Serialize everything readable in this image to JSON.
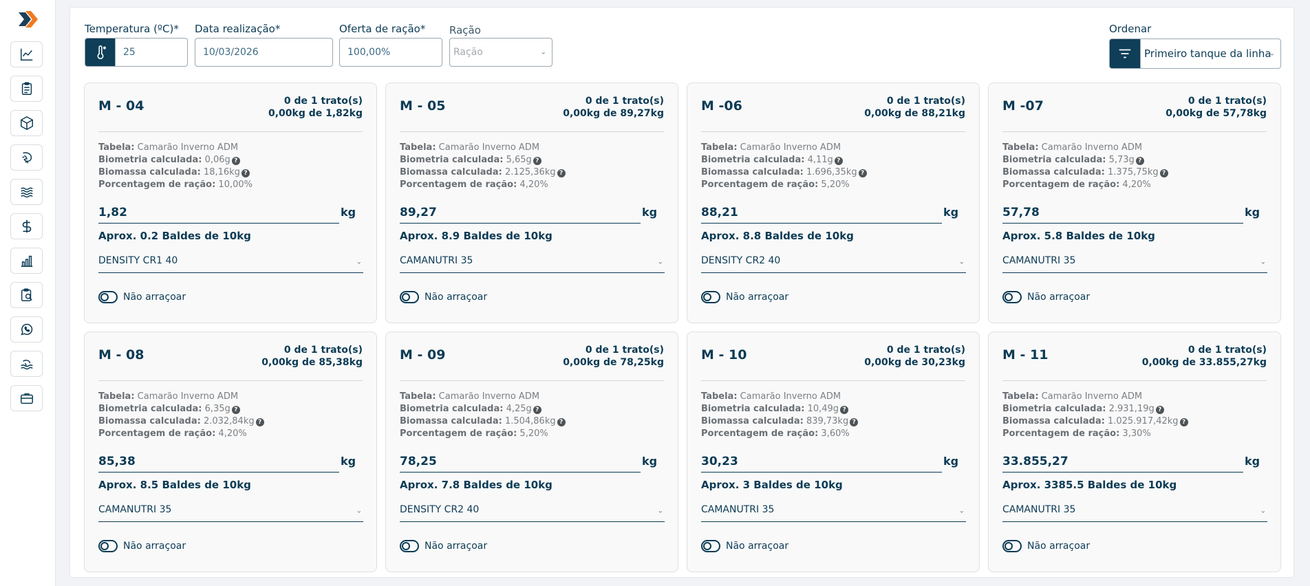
{
  "sidebar": {
    "icons": [
      "trend-chart-icon",
      "clipboard-icon",
      "box-icon",
      "shrimp-icon",
      "water-waves-icon",
      "dollar-icon",
      "bar-chart-icon",
      "inspection-icon",
      "whatsapp-icon",
      "shrimp-farm-icon",
      "briefcase-icon"
    ]
  },
  "filters": {
    "temperatura_label": "Temperatura (ºC)*",
    "temperatura_value": "25",
    "data_label": "Data realização*",
    "data_value": "10/03/2026",
    "oferta_label": "Oferta de ração*",
    "oferta_value": "100,00%",
    "racao_label": "Ração",
    "racao_placeholder": "Ração",
    "ordenar_label": "Ordenar",
    "ordenar_value": "Primeiro tanque da linha"
  },
  "labels": {
    "tabela": "Tabela:",
    "biometria": "Biometria calculada:",
    "biomassa": "Biomassa calculada:",
    "porcentagem": "Porcentagem de ração:",
    "kg": "kg",
    "nao_arracoar": "Não arraçoar"
  },
  "cards": [
    {
      "name": "M - 04",
      "trato": "0 de 1 trato(s)",
      "kg_summary": "0,00kg de 1,82kg",
      "tabela": "Camarão Inverno ADM",
      "biometria": "0,06g",
      "biomassa": "18,16kg",
      "porcentagem": "10,00%",
      "qty": "1,82",
      "aprox": "Aprox. 0.2 Baldes de 10kg",
      "racao": "DENSITY CR1 40"
    },
    {
      "name": "M - 05",
      "trato": "0 de 1 trato(s)",
      "kg_summary": "0,00kg de 89,27kg",
      "tabela": "Camarão Inverno ADM",
      "biometria": "5,65g",
      "biomassa": "2.125,36kg",
      "porcentagem": "4,20%",
      "qty": "89,27",
      "aprox": "Aprox. 8.9 Baldes de 10kg",
      "racao": "CAMANUTRI 35"
    },
    {
      "name": "M -06",
      "trato": "0 de 1 trato(s)",
      "kg_summary": "0,00kg de 88,21kg",
      "tabela": "Camarão Inverno ADM",
      "biometria": "4,11g",
      "biomassa": "1.696,35kg",
      "porcentagem": "5,20%",
      "qty": "88,21",
      "aprox": "Aprox. 8.8 Baldes de 10kg",
      "racao": "DENSITY CR2 40"
    },
    {
      "name": "M -07",
      "trato": "0 de 1 trato(s)",
      "kg_summary": "0,00kg de 57,78kg",
      "tabela": "Camarão Inverno ADM",
      "biometria": "5,73g",
      "biomassa": "1.375,75kg",
      "porcentagem": "4,20%",
      "qty": "57,78",
      "aprox": "Aprox. 5.8 Baldes de 10kg",
      "racao": "CAMANUTRI 35"
    },
    {
      "name": "M - 08",
      "trato": "0 de 1 trato(s)",
      "kg_summary": "0,00kg de 85,38kg",
      "tabela": "Camarão Inverno ADM",
      "biometria": "6,35g",
      "biomassa": "2.032,84kg",
      "porcentagem": "4,20%",
      "qty": "85,38",
      "aprox": "Aprox. 8.5 Baldes de 10kg",
      "racao": "CAMANUTRI 35"
    },
    {
      "name": "M - 09",
      "trato": "0 de 1 trato(s)",
      "kg_summary": "0,00kg de 78,25kg",
      "tabela": "Camarão Inverno ADM",
      "biometria": "4,25g",
      "biomassa": "1.504,86kg",
      "porcentagem": "5,20%",
      "qty": "78,25",
      "aprox": "Aprox. 7.8 Baldes de 10kg",
      "racao": "DENSITY CR2 40"
    },
    {
      "name": "M - 10",
      "trato": "0 de 1 trato(s)",
      "kg_summary": "0,00kg de 30,23kg",
      "tabela": "Camarão Inverno ADM",
      "biometria": "10,49g",
      "biomassa": "839,73kg",
      "porcentagem": "3,60%",
      "qty": "30,23",
      "aprox": "Aprox. 3 Baldes de 10kg",
      "racao": "CAMANUTRI 35"
    },
    {
      "name": "M - 11",
      "trato": "0 de 1 trato(s)",
      "kg_summary": "0,00kg de 33.855,27kg",
      "tabela": "Camarão Inverno ADM",
      "biometria": "2.931,19g",
      "biomassa": "1.025.917,42kg",
      "porcentagem": "3,30%",
      "qty": "33.855,27",
      "aprox": "Aprox. 3385.5 Baldes de 10kg",
      "racao": "CAMANUTRI 35"
    }
  ]
}
